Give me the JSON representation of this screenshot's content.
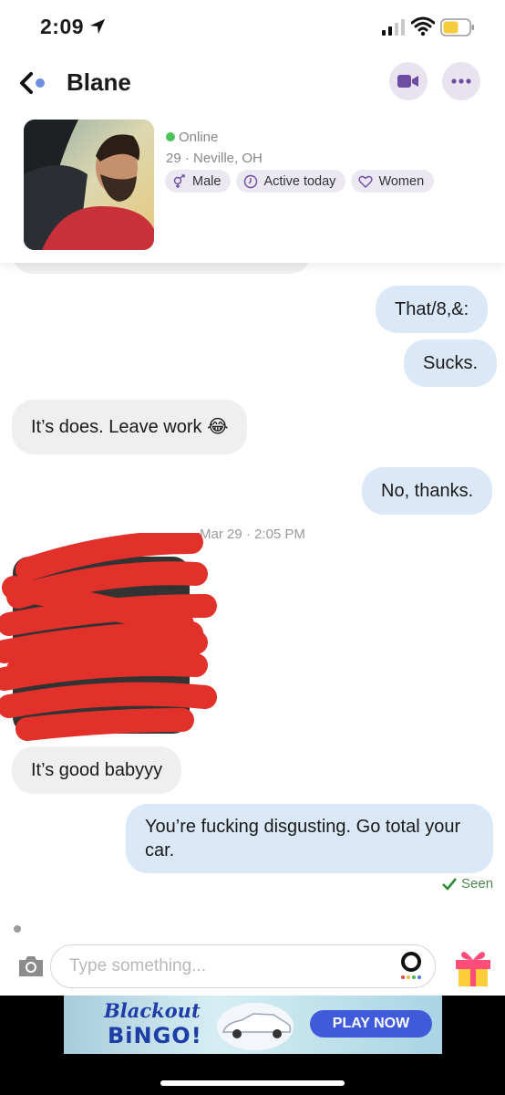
{
  "status_bar": {
    "time": "2:09"
  },
  "header": {
    "contact_name": "Blane"
  },
  "profile": {
    "status": "Online",
    "location": "29 · Neville, OH",
    "chips": [
      "Male",
      "Active today",
      "Women"
    ]
  },
  "messages": {
    "out_1": "That/8,&:",
    "out_2": "Sucks.",
    "in_1": "It’s does. Leave work 😂",
    "out_3": "No, thanks.",
    "timestamp": "Mar 29 · 2:05 PM",
    "in_2": "It’s good babyyy",
    "out_4": "You’re fucking disgusting. Go total your car.",
    "seen": "Seen"
  },
  "input": {
    "placeholder": "Type something..."
  },
  "ad": {
    "brand_line1": "Blackout",
    "brand_line2": "BiNGO!",
    "cta": "PLAY NOW"
  },
  "colors": {
    "accent": "#6d4ca3",
    "online": "#4cc25a",
    "outgoing_bubble": "#dbe8f7",
    "incoming_bubble": "#efefef",
    "scribble": "#e2302a"
  }
}
